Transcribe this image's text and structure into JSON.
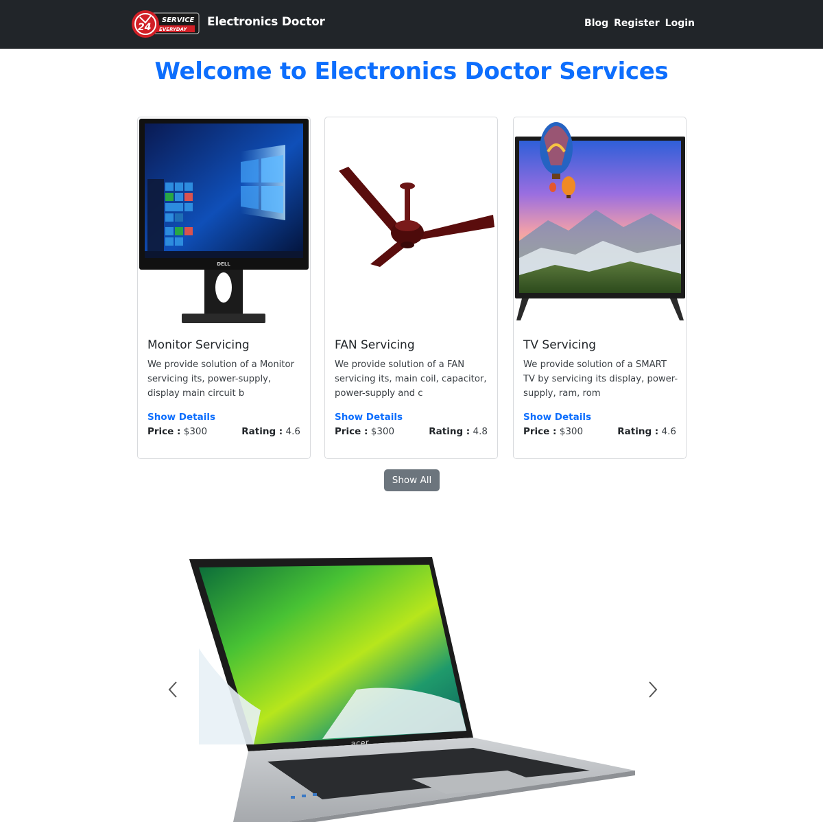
{
  "navbar": {
    "brand_name": "Electronics Doctor",
    "logo": {
      "top_text": "SERVICE",
      "number": "24",
      "bottom_text": "EVERYDAY"
    },
    "links": [
      "Blog",
      "Register",
      "Login"
    ]
  },
  "page_title": "Welcome to Electronics Doctor Services",
  "cards": [
    {
      "title": "Monitor Servicing",
      "description": "We provide solution of a Monitor servicing its, power-supply, display main circuit b",
      "link": "Show Details",
      "price_label": "Price :",
      "price": "$300",
      "rating_label": "Rating :",
      "rating": "4.6",
      "image": "monitor-image"
    },
    {
      "title": "FAN Servicing",
      "description": "We provide solution of a FAN servicing its, main coil, capacitor, power-supply and c",
      "link": "Show Details",
      "price_label": "Price :",
      "price": "$300",
      "rating_label": "Rating :",
      "rating": "4.8",
      "image": "ceiling-fan-image"
    },
    {
      "title": "TV Servicing",
      "description": "We provide solution of a SMART TV by servicing its display, power-supply, ram, rom",
      "link": "Show Details",
      "price_label": "Price :",
      "price": "$300",
      "rating_label": "Rating :",
      "rating": "4.6",
      "image": "smart-tv-image"
    }
  ],
  "show_all_label": "Show All",
  "carousel": {
    "slide_image": "laptop-image",
    "laptop_brand": "acer",
    "prev_icon": "chevron-left-icon",
    "next_icon": "chevron-right-icon"
  },
  "colors": {
    "navbar_bg": "#212529",
    "primary": "#0d6efd",
    "secondary_button": "#6c757d"
  }
}
